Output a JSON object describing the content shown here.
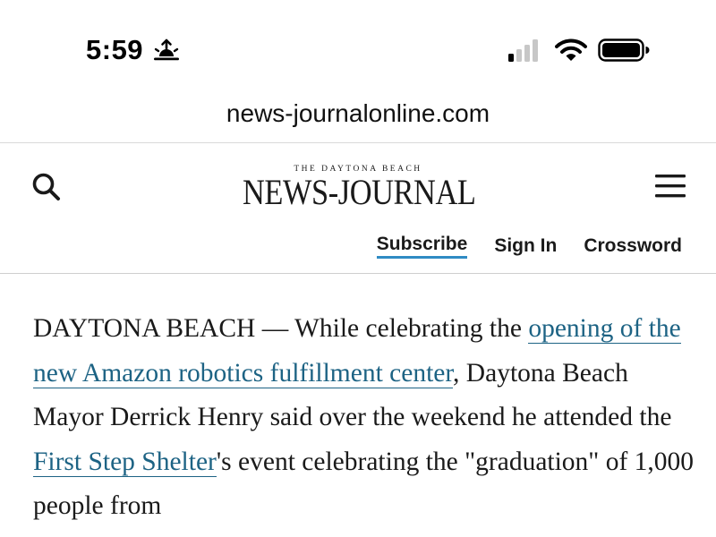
{
  "status_bar": {
    "time": "5:59",
    "sunrise_icon": "sunrise-icon",
    "signal_icon": "cellular-signal-icon",
    "wifi_icon": "wifi-icon",
    "battery_icon": "battery-icon"
  },
  "browser": {
    "url": "news-journalonline.com"
  },
  "site_header": {
    "logo_top": "THE DAYTONA BEACH",
    "logo_main": "NEWS-JOURNAL",
    "search_icon": "search-icon",
    "menu_icon": "hamburger-menu-icon",
    "links": {
      "subscribe": "Subscribe",
      "sign_in": "Sign In",
      "crossword": "Crossword"
    }
  },
  "article": {
    "seg1": "DAYTONA BEACH — While celebrating the ",
    "link1": "opening of the new Amazon robotics fulfillment center",
    "seg2": ", Daytona Beach Mayor Derrick Henry said over the weekend he attended the ",
    "link2": "First Step Shelter",
    "seg3": "'s event celebrating the \"graduation\" of 1,000 people from"
  },
  "colors": {
    "link": "#1d6384",
    "subscribe_underline": "#2f8bc4"
  }
}
